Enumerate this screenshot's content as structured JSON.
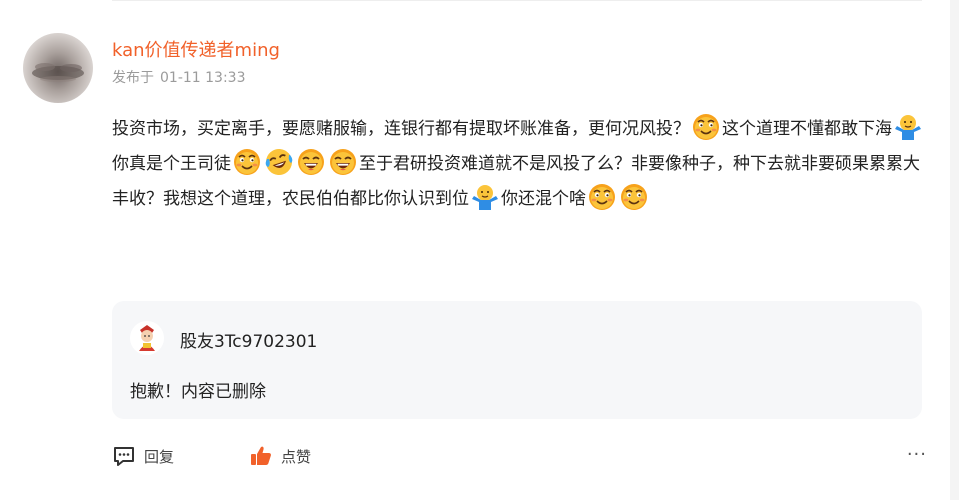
{
  "post": {
    "username": "kan价值传递者ming",
    "time_label": "发布于",
    "time_value": "01-11 13:33",
    "content": [
      {
        "t": "text",
        "v": "投资市场，买定离手，要愿赌服输，连银行都有提取坏账准备，更何况风投？"
      },
      {
        "t": "emoji",
        "v": "smirk"
      },
      {
        "t": "text",
        "v": "这个道理不懂都敢下海"
      },
      {
        "t": "emoji",
        "v": "shrug"
      },
      {
        "t": "text",
        "v": "你真是个王司徒"
      },
      {
        "t": "emoji",
        "v": "smirk"
      },
      {
        "t": "emoji",
        "v": "cry-laugh"
      },
      {
        "t": "emoji",
        "v": "grin"
      },
      {
        "t": "emoji",
        "v": "grin"
      },
      {
        "t": "text",
        "v": "至于君研投资难道就不是风投了么？非要像种子，种下去就非要硕果累累大丰收？我想这个道理，农民伯伯都比你认识到位"
      },
      {
        "t": "emoji",
        "v": "shrug"
      },
      {
        "t": "text",
        "v": "你还混个啥"
      },
      {
        "t": "emoji",
        "v": "smirk"
      },
      {
        "t": "emoji",
        "v": "smirk"
      }
    ]
  },
  "reply": {
    "username": "股友3Tc9702301",
    "text": "抱歉！内容已删除"
  },
  "actions": {
    "reply_label": "回复",
    "like_label": "点赞",
    "more_label": "···"
  },
  "colors": {
    "username": "#f1612a",
    "like_icon": "#f1612a",
    "reply_bg": "#f6f7f9"
  },
  "icons": {
    "reply": "comment-icon",
    "like": "thumbs-up-icon",
    "more": "more-dots-icon"
  }
}
